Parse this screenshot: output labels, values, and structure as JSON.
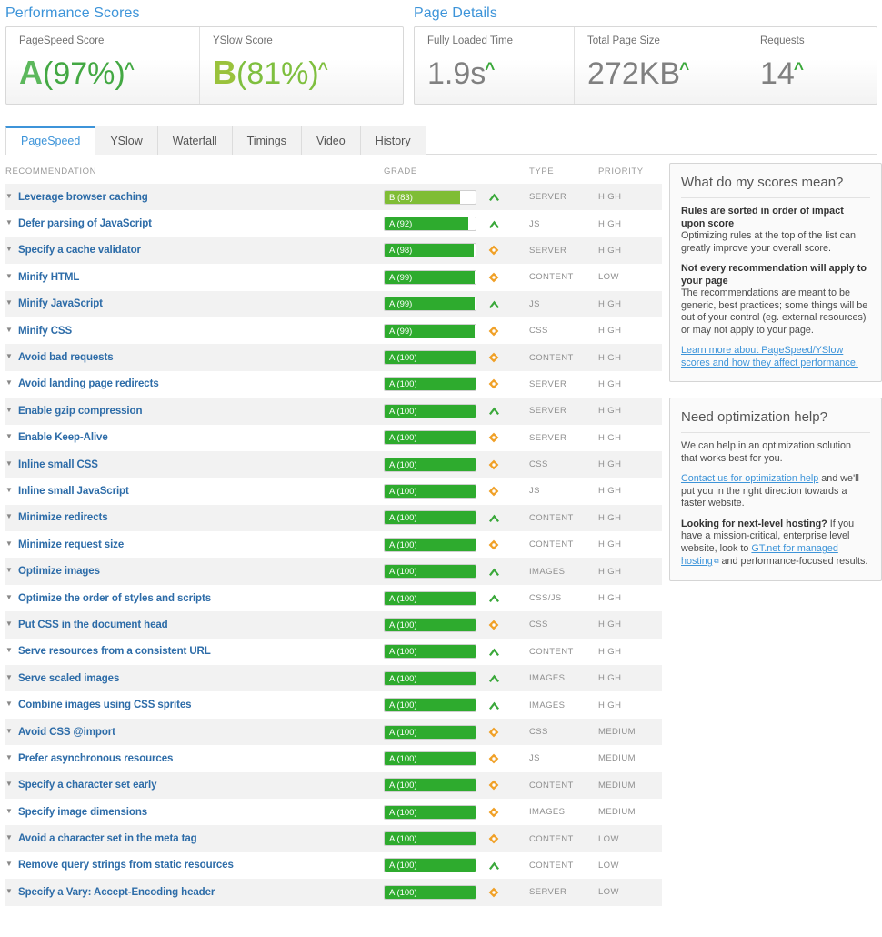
{
  "performance_scores": {
    "title": "Performance Scores",
    "metrics": [
      {
        "label": "PageSpeed Score",
        "grade": "A",
        "value": "(97%)",
        "caret": "^",
        "grade_class": "grade-a"
      },
      {
        "label": "YSlow Score",
        "grade": "B",
        "value": "(81%)",
        "caret": "^",
        "grade_class": "grade-b"
      }
    ]
  },
  "page_details": {
    "title": "Page Details",
    "metrics": [
      {
        "label": "Fully Loaded Time",
        "value": "1.9s",
        "caret": "^"
      },
      {
        "label": "Total Page Size",
        "value": "272KB",
        "caret": "^"
      },
      {
        "label": "Requests",
        "value": "14",
        "caret": "^"
      }
    ]
  },
  "tabs": [
    {
      "label": "PageSpeed",
      "active": true
    },
    {
      "label": "YSlow",
      "active": false
    },
    {
      "label": "Waterfall",
      "active": false
    },
    {
      "label": "Timings",
      "active": false
    },
    {
      "label": "Video",
      "active": false
    },
    {
      "label": "History",
      "active": false
    }
  ],
  "table": {
    "headers": {
      "recommendation": "RECOMMENDATION",
      "grade": "GRADE",
      "type": "TYPE",
      "priority": "PRIORITY"
    },
    "rows": [
      {
        "recommendation": "Leverage browser caching",
        "grade": "B (83)",
        "score": 83,
        "letter": "B",
        "icon": "chevron-up",
        "type": "SERVER",
        "priority": "HIGH"
      },
      {
        "recommendation": "Defer parsing of JavaScript",
        "grade": "A (92)",
        "score": 92,
        "letter": "A",
        "icon": "chevron-up",
        "type": "JS",
        "priority": "HIGH"
      },
      {
        "recommendation": "Specify a cache validator",
        "grade": "A (98)",
        "score": 98,
        "letter": "A",
        "icon": "diamond",
        "type": "SERVER",
        "priority": "HIGH"
      },
      {
        "recommendation": "Minify HTML",
        "grade": "A (99)",
        "score": 99,
        "letter": "A",
        "icon": "diamond",
        "type": "CONTENT",
        "priority": "LOW"
      },
      {
        "recommendation": "Minify JavaScript",
        "grade": "A (99)",
        "score": 99,
        "letter": "A",
        "icon": "chevron-up",
        "type": "JS",
        "priority": "HIGH"
      },
      {
        "recommendation": "Minify CSS",
        "grade": "A (99)",
        "score": 99,
        "letter": "A",
        "icon": "diamond",
        "type": "CSS",
        "priority": "HIGH"
      },
      {
        "recommendation": "Avoid bad requests",
        "grade": "A (100)",
        "score": 100,
        "letter": "A",
        "icon": "diamond",
        "type": "CONTENT",
        "priority": "HIGH"
      },
      {
        "recommendation": "Avoid landing page redirects",
        "grade": "A (100)",
        "score": 100,
        "letter": "A",
        "icon": "diamond",
        "type": "SERVER",
        "priority": "HIGH"
      },
      {
        "recommendation": "Enable gzip compression",
        "grade": "A (100)",
        "score": 100,
        "letter": "A",
        "icon": "chevron-up",
        "type": "SERVER",
        "priority": "HIGH"
      },
      {
        "recommendation": "Enable Keep-Alive",
        "grade": "A (100)",
        "score": 100,
        "letter": "A",
        "icon": "diamond",
        "type": "SERVER",
        "priority": "HIGH"
      },
      {
        "recommendation": "Inline small CSS",
        "grade": "A (100)",
        "score": 100,
        "letter": "A",
        "icon": "diamond",
        "type": "CSS",
        "priority": "HIGH"
      },
      {
        "recommendation": "Inline small JavaScript",
        "grade": "A (100)",
        "score": 100,
        "letter": "A",
        "icon": "diamond",
        "type": "JS",
        "priority": "HIGH"
      },
      {
        "recommendation": "Minimize redirects",
        "grade": "A (100)",
        "score": 100,
        "letter": "A",
        "icon": "chevron-up",
        "type": "CONTENT",
        "priority": "HIGH"
      },
      {
        "recommendation": "Minimize request size",
        "grade": "A (100)",
        "score": 100,
        "letter": "A",
        "icon": "diamond",
        "type": "CONTENT",
        "priority": "HIGH"
      },
      {
        "recommendation": "Optimize images",
        "grade": "A (100)",
        "score": 100,
        "letter": "A",
        "icon": "chevron-up",
        "type": "IMAGES",
        "priority": "HIGH"
      },
      {
        "recommendation": "Optimize the order of styles and scripts",
        "grade": "A (100)",
        "score": 100,
        "letter": "A",
        "icon": "chevron-up",
        "type": "CSS/JS",
        "priority": "HIGH"
      },
      {
        "recommendation": "Put CSS in the document head",
        "grade": "A (100)",
        "score": 100,
        "letter": "A",
        "icon": "diamond",
        "type": "CSS",
        "priority": "HIGH"
      },
      {
        "recommendation": "Serve resources from a consistent URL",
        "grade": "A (100)",
        "score": 100,
        "letter": "A",
        "icon": "chevron-up",
        "type": "CONTENT",
        "priority": "HIGH"
      },
      {
        "recommendation": "Serve scaled images",
        "grade": "A (100)",
        "score": 100,
        "letter": "A",
        "icon": "chevron-up",
        "type": "IMAGES",
        "priority": "HIGH"
      },
      {
        "recommendation": "Combine images using CSS sprites",
        "grade": "A (100)",
        "score": 100,
        "letter": "A",
        "icon": "chevron-up",
        "type": "IMAGES",
        "priority": "HIGH"
      },
      {
        "recommendation": "Avoid CSS @import",
        "grade": "A (100)",
        "score": 100,
        "letter": "A",
        "icon": "diamond",
        "type": "CSS",
        "priority": "MEDIUM"
      },
      {
        "recommendation": "Prefer asynchronous resources",
        "grade": "A (100)",
        "score": 100,
        "letter": "A",
        "icon": "diamond",
        "type": "JS",
        "priority": "MEDIUM"
      },
      {
        "recommendation": "Specify a character set early",
        "grade": "A (100)",
        "score": 100,
        "letter": "A",
        "icon": "diamond",
        "type": "CONTENT",
        "priority": "MEDIUM"
      },
      {
        "recommendation": "Specify image dimensions",
        "grade": "A (100)",
        "score": 100,
        "letter": "A",
        "icon": "diamond",
        "type": "IMAGES",
        "priority": "MEDIUM"
      },
      {
        "recommendation": "Avoid a character set in the meta tag",
        "grade": "A (100)",
        "score": 100,
        "letter": "A",
        "icon": "diamond",
        "type": "CONTENT",
        "priority": "LOW"
      },
      {
        "recommendation": "Remove query strings from static resources",
        "grade": "A (100)",
        "score": 100,
        "letter": "A",
        "icon": "chevron-up",
        "type": "CONTENT",
        "priority": "LOW"
      },
      {
        "recommendation": "Specify a Vary: Accept-Encoding header",
        "grade": "A (100)",
        "score": 100,
        "letter": "A",
        "icon": "diamond",
        "type": "SERVER",
        "priority": "LOW"
      }
    ]
  },
  "sidebar": {
    "scores_card": {
      "title": "What do my scores mean?",
      "para1_bold": "Rules are sorted in order of impact upon score",
      "para1_text": "Optimizing rules at the top of the list can greatly improve your overall score.",
      "para2_bold": "Not every recommendation will apply to your page",
      "para2_text": "The recommendations are meant to be generic, best practices; some things will be out of your control (eg. external resources) or may not apply to your page.",
      "link": "Learn more about PageSpeed/YSlow scores and how they affect performance."
    },
    "help_card": {
      "title": "Need optimization help?",
      "para1": "We can help in an optimization solution that works best for you.",
      "link1": "Contact us for optimization help",
      "para2_after_link1": " and we'll put you in the right direction towards a faster website.",
      "para3_bold": "Looking for next-level hosting?",
      "para3_text_a": " If you have a mission-critical, enterprise level website, look to ",
      "link2": "GT.net for managed hosting",
      "ext_icon": "⧉",
      "para3_text_b": " and performance-focused results."
    }
  },
  "colors": {
    "accent_blue": "#3d94d9",
    "link_blue": "#2d6ca8",
    "grade_a_green": "#2eab2e",
    "grade_b_green": "#7fbd35",
    "icon_orange": "#f0a026",
    "icon_green": "#3aa83a",
    "row_stripe": "#f2f2f2"
  }
}
